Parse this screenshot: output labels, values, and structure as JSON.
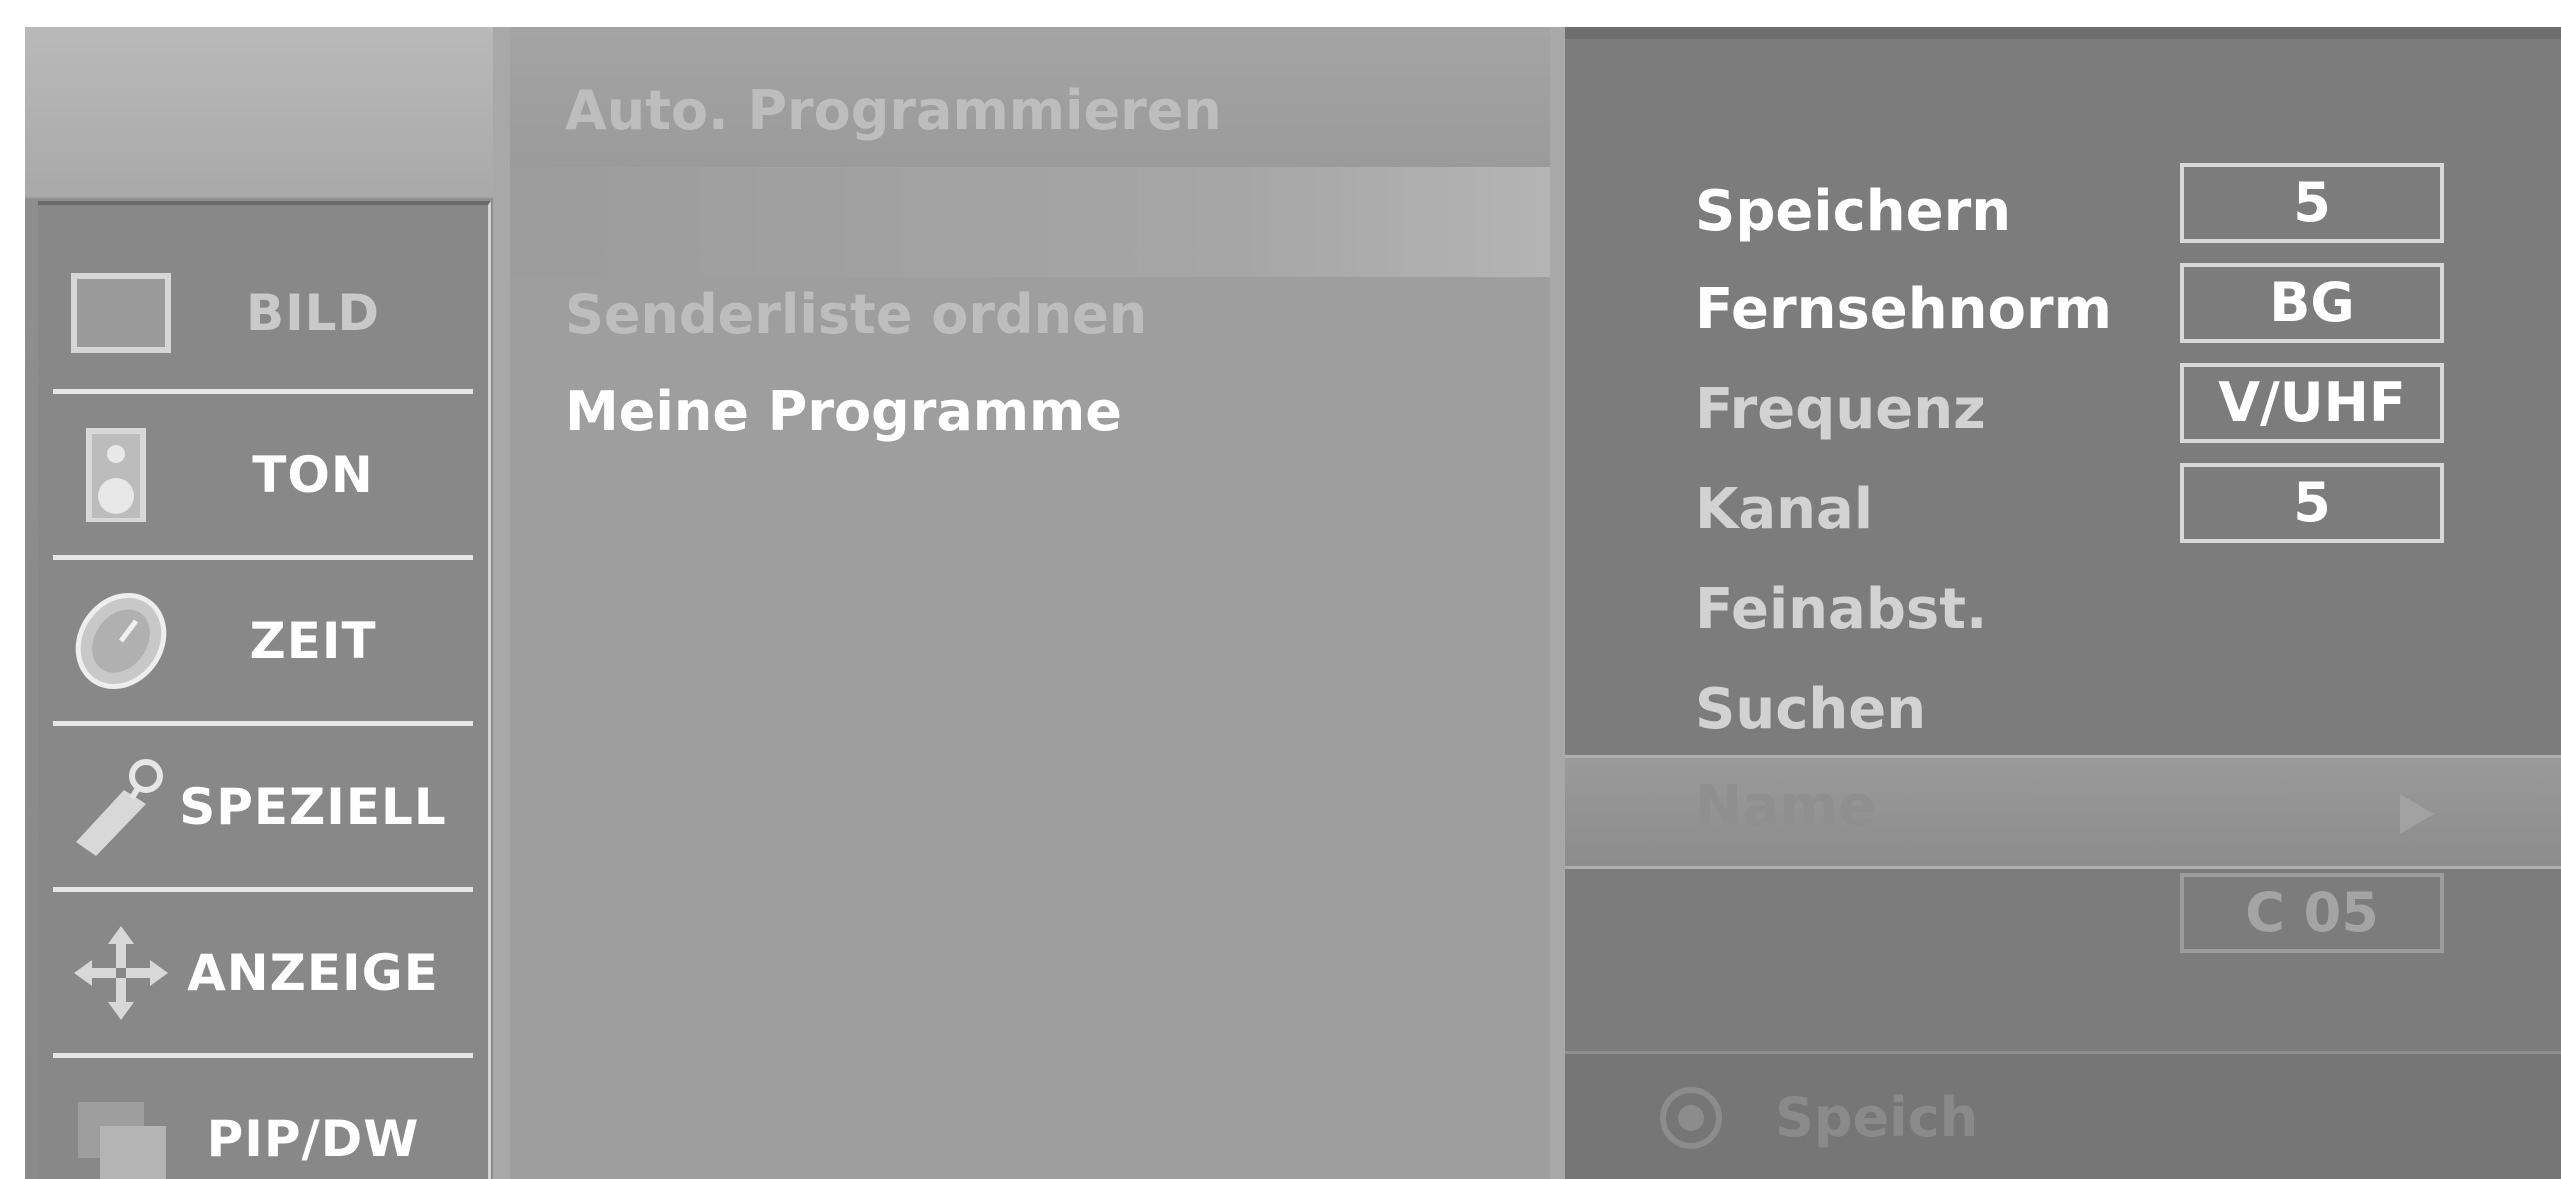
{
  "sidebar": {
    "items": [
      {
        "label": "BILD",
        "icon": "picture-icon"
      },
      {
        "label": "TON",
        "icon": "speaker-icon"
      },
      {
        "label": "ZEIT",
        "icon": "clock-icon"
      },
      {
        "label": "SPEZIELL",
        "icon": "key-icon"
      },
      {
        "label": "ANZEIGE",
        "icon": "arrows-icon"
      },
      {
        "label": "PIP/DW",
        "icon": "pip-icon"
      }
    ]
  },
  "middle": {
    "items": [
      {
        "label": "Auto. Programmieren"
      },
      {
        "label": "Senderliste ordnen"
      },
      {
        "label": "Meine Programme"
      }
    ]
  },
  "settings": {
    "rows": [
      {
        "label": "Speichern",
        "value": "5"
      },
      {
        "label": "Fernsehnorm",
        "value": "BG"
      },
      {
        "label": "Frequenz",
        "value": "V/UHF"
      },
      {
        "label": "Kanal",
        "value": "5"
      },
      {
        "label": "Feinabst."
      },
      {
        "label": "Suchen"
      }
    ],
    "name": {
      "label": "Name",
      "value": "C 05"
    }
  },
  "bottom": {
    "label": "Speich",
    "icon": "radio-icon"
  }
}
